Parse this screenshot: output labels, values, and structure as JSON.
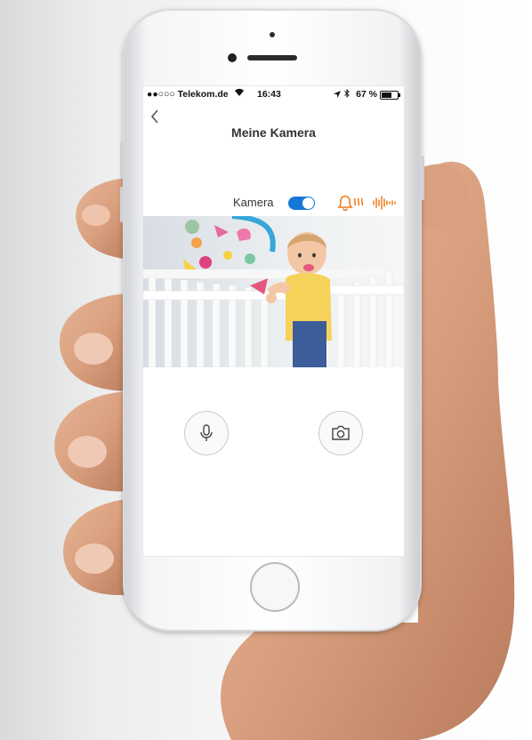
{
  "status_bar": {
    "carrier": "●●○○○ Telekom.de",
    "time": "16:43",
    "battery": "67 %",
    "battery_level": 0.67
  },
  "header": {
    "back_icon": "chevron-left-icon",
    "title": "Meine Kamera"
  },
  "camera_row": {
    "label": "Kamera",
    "toggle_on": true,
    "alarm_icon": "bell-heat-icon",
    "sound_icon": "sound-wave-icon",
    "accent_color": "#f07c1e"
  },
  "controls": {
    "mic_icon": "microphone-icon",
    "snapshot_icon": "camera-icon"
  },
  "colors": {
    "toggle": "#1677d8",
    "accent": "#f07c1e"
  }
}
